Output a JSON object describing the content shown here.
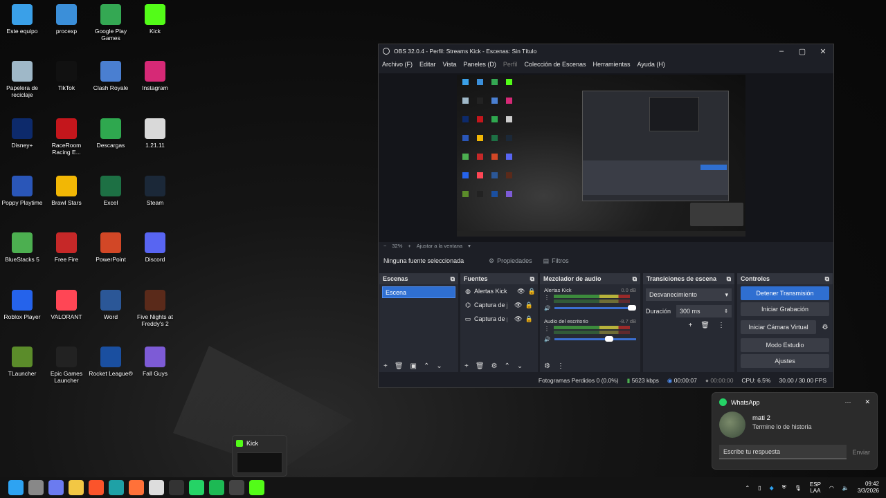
{
  "desktop": {
    "icons": [
      {
        "label": "Este equipo",
        "icon": "monitor-icon",
        "color": "#3aa0e8"
      },
      {
        "label": "procexp",
        "icon": "process-explorer-icon",
        "color": "#3b8fd9"
      },
      {
        "label": "Google Play Games",
        "icon": "google-play-games-icon",
        "color": "#34a853"
      },
      {
        "label": "Kick",
        "icon": "kick-icon",
        "color": "#53fc18"
      },
      {
        "label": "Papelera de reciclaje",
        "icon": "recycle-bin-icon",
        "color": "#9fb8c8"
      },
      {
        "label": "TikTok",
        "icon": "tiktok-icon",
        "color": "#111111"
      },
      {
        "label": "Clash Royale",
        "icon": "clash-royale-icon",
        "color": "#4a7fd1"
      },
      {
        "label": "Instagram",
        "icon": "instagram-icon",
        "color": "#d62976"
      },
      {
        "label": "Disney+",
        "icon": "disney-plus-icon",
        "color": "#0d2a6b"
      },
      {
        "label": "RaceRoom Racing E...",
        "icon": "raceroom-icon",
        "color": "#c4161c"
      },
      {
        "label": "Descargas",
        "icon": "downloads-icon",
        "color": "#2fa84f"
      },
      {
        "label": "1.21.11",
        "icon": "minecraft-version-icon",
        "color": "#d9d9d9"
      },
      {
        "label": "Poppy Playtime",
        "icon": "poppy-playtime-icon",
        "color": "#2a56b8"
      },
      {
        "label": "Brawl Stars",
        "icon": "brawl-stars-icon",
        "color": "#f2b705"
      },
      {
        "label": "Excel",
        "icon": "excel-icon",
        "color": "#1d7044"
      },
      {
        "label": "Steam",
        "icon": "steam-icon",
        "color": "#1b2838"
      },
      {
        "label": "BlueStacks 5",
        "icon": "bluestacks-icon",
        "color": "#4caf50"
      },
      {
        "label": "Free Fire",
        "icon": "free-fire-icon",
        "color": "#c62828"
      },
      {
        "label": "PowerPoint",
        "icon": "powerpoint-icon",
        "color": "#d24726"
      },
      {
        "label": "Discord",
        "icon": "discord-icon",
        "color": "#5865f2"
      },
      {
        "label": "Roblox Player",
        "icon": "roblox-icon",
        "color": "#2563eb"
      },
      {
        "label": "VALORANT",
        "icon": "valorant-icon",
        "color": "#ff4655"
      },
      {
        "label": "Word",
        "icon": "word-icon",
        "color": "#2b5797"
      },
      {
        "label": "Five Nights at Freddy's 2",
        "icon": "fnaf2-icon",
        "color": "#5a2a1a"
      },
      {
        "label": "TLauncher",
        "icon": "tlauncher-icon",
        "color": "#5b8c2a"
      },
      {
        "label": "Epic Games Launcher",
        "icon": "epic-games-icon",
        "color": "#222222"
      },
      {
        "label": "Rocket League®",
        "icon": "rocket-league-icon",
        "color": "#1a4fa0"
      },
      {
        "label": "Fall Guys",
        "icon": "fall-guys-icon",
        "color": "#7d5bd6"
      }
    ]
  },
  "obs": {
    "title": "OBS 32.0.4 - Perfil: Streams Kick - Escenas: Sin Título",
    "menu": [
      "Archivo (F)",
      "Editar",
      "Vista",
      "Paneles (D)",
      "Perfil",
      "Colección de Escenas",
      "Herramientas",
      "Ayuda (H)"
    ],
    "zoom": {
      "minus": "−",
      "value": "32%",
      "plus": "+",
      "fit": "Ajustar a la ventana"
    },
    "source_toolbar": {
      "no_source": "Ninguna fuente seleccionada",
      "properties": "Propiedades",
      "filters": "Filtros"
    },
    "docks": {
      "scenes": {
        "title": "Escenas",
        "items": [
          "Escena"
        ]
      },
      "sources": {
        "title": "Fuentes",
        "items": [
          {
            "name": "Alertas Kick",
            "icon": "globe-icon"
          },
          {
            "name": "Captura de juego",
            "icon": "gamepad-icon"
          },
          {
            "name": "Captura de pantalla",
            "icon": "monitor-icon"
          }
        ]
      },
      "mixer": {
        "title": "Mezclador de audio",
        "tracks": [
          {
            "name": "Alertas Kick",
            "db": "0.0 dB",
            "volume": 1.0
          },
          {
            "name": "Audio del escritorio",
            "db": "-8.7 dB",
            "volume": 0.72
          }
        ]
      },
      "transitions": {
        "title": "Transiciones de escena",
        "selected": "Desvanecimiento",
        "duration_label": "Duración",
        "duration_value": "300 ms"
      },
      "controls": {
        "title": "Controles",
        "buttons": [
          "Detener Transmisión",
          "Iniciar Grabación",
          "Iniciar Cámara Virtual",
          "Modo Estudio",
          "Ajustes"
        ]
      }
    },
    "status": {
      "dropped": "Fotogramas Perdidos 0 (0.0%)",
      "bitrate": "5623 kbps",
      "stream_time": "00:00:07",
      "rec_time": "00:00:00",
      "cpu": "CPU: 6.5%",
      "fps": "30.00 / 30.00 FPS"
    }
  },
  "whatsapp": {
    "app": "WhatsApp",
    "sender": "mati 2",
    "message": "Termine lo de historia",
    "reply_placeholder": "Escribe tu respuesta",
    "send": "Enviar"
  },
  "kick_preview": {
    "title": "Kick"
  },
  "taskbar": {
    "apps": [
      "windows-start-icon",
      "task-view-icon",
      "copilot-icon",
      "file-explorer-icon",
      "brave-icon",
      "edge-icon",
      "firefox-icon",
      "store-icon",
      "epic-games-icon",
      "whatsapp-icon",
      "spotify-icon",
      "obs-icon",
      "kick-icon"
    ],
    "tray": {
      "lang_1": "ESP",
      "lang_2": "LAA",
      "time": "09:42",
      "date": "3/3/2026"
    }
  }
}
